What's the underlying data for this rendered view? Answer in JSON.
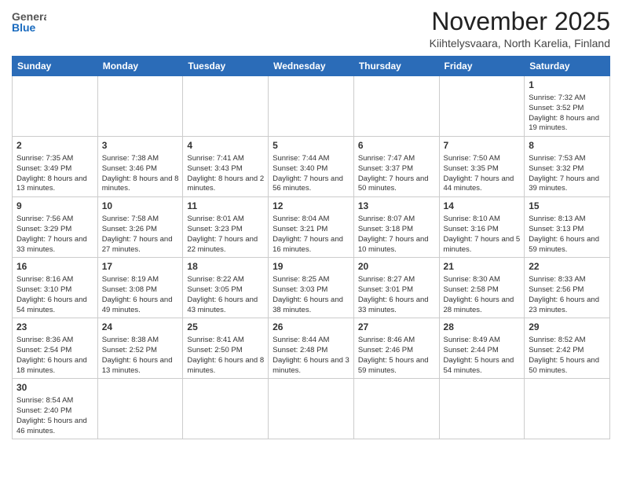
{
  "header": {
    "logo_general": "General",
    "logo_blue": "Blue",
    "month": "November 2025",
    "location": "Kiihtelysvaara, North Karelia, Finland"
  },
  "weekdays": [
    "Sunday",
    "Monday",
    "Tuesday",
    "Wednesday",
    "Thursday",
    "Friday",
    "Saturday"
  ],
  "rows": [
    [
      {
        "day": "",
        "info": ""
      },
      {
        "day": "",
        "info": ""
      },
      {
        "day": "",
        "info": ""
      },
      {
        "day": "",
        "info": ""
      },
      {
        "day": "",
        "info": ""
      },
      {
        "day": "",
        "info": ""
      },
      {
        "day": "1",
        "info": "Sunrise: 7:32 AM\nSunset: 3:52 PM\nDaylight: 8 hours\nand 19 minutes."
      }
    ],
    [
      {
        "day": "2",
        "info": "Sunrise: 7:35 AM\nSunset: 3:49 PM\nDaylight: 8 hours\nand 13 minutes."
      },
      {
        "day": "3",
        "info": "Sunrise: 7:38 AM\nSunset: 3:46 PM\nDaylight: 8 hours\nand 8 minutes."
      },
      {
        "day": "4",
        "info": "Sunrise: 7:41 AM\nSunset: 3:43 PM\nDaylight: 8 hours\nand 2 minutes."
      },
      {
        "day": "5",
        "info": "Sunrise: 7:44 AM\nSunset: 3:40 PM\nDaylight: 7 hours\nand 56 minutes."
      },
      {
        "day": "6",
        "info": "Sunrise: 7:47 AM\nSunset: 3:37 PM\nDaylight: 7 hours\nand 50 minutes."
      },
      {
        "day": "7",
        "info": "Sunrise: 7:50 AM\nSunset: 3:35 PM\nDaylight: 7 hours\nand 44 minutes."
      },
      {
        "day": "8",
        "info": "Sunrise: 7:53 AM\nSunset: 3:32 PM\nDaylight: 7 hours\nand 39 minutes."
      }
    ],
    [
      {
        "day": "9",
        "info": "Sunrise: 7:56 AM\nSunset: 3:29 PM\nDaylight: 7 hours\nand 33 minutes."
      },
      {
        "day": "10",
        "info": "Sunrise: 7:58 AM\nSunset: 3:26 PM\nDaylight: 7 hours\nand 27 minutes."
      },
      {
        "day": "11",
        "info": "Sunrise: 8:01 AM\nSunset: 3:23 PM\nDaylight: 7 hours\nand 22 minutes."
      },
      {
        "day": "12",
        "info": "Sunrise: 8:04 AM\nSunset: 3:21 PM\nDaylight: 7 hours\nand 16 minutes."
      },
      {
        "day": "13",
        "info": "Sunrise: 8:07 AM\nSunset: 3:18 PM\nDaylight: 7 hours\nand 10 minutes."
      },
      {
        "day": "14",
        "info": "Sunrise: 8:10 AM\nSunset: 3:16 PM\nDaylight: 7 hours\nand 5 minutes."
      },
      {
        "day": "15",
        "info": "Sunrise: 8:13 AM\nSunset: 3:13 PM\nDaylight: 6 hours\nand 59 minutes."
      }
    ],
    [
      {
        "day": "16",
        "info": "Sunrise: 8:16 AM\nSunset: 3:10 PM\nDaylight: 6 hours\nand 54 minutes."
      },
      {
        "day": "17",
        "info": "Sunrise: 8:19 AM\nSunset: 3:08 PM\nDaylight: 6 hours\nand 49 minutes."
      },
      {
        "day": "18",
        "info": "Sunrise: 8:22 AM\nSunset: 3:05 PM\nDaylight: 6 hours\nand 43 minutes."
      },
      {
        "day": "19",
        "info": "Sunrise: 8:25 AM\nSunset: 3:03 PM\nDaylight: 6 hours\nand 38 minutes."
      },
      {
        "day": "20",
        "info": "Sunrise: 8:27 AM\nSunset: 3:01 PM\nDaylight: 6 hours\nand 33 minutes."
      },
      {
        "day": "21",
        "info": "Sunrise: 8:30 AM\nSunset: 2:58 PM\nDaylight: 6 hours\nand 28 minutes."
      },
      {
        "day": "22",
        "info": "Sunrise: 8:33 AM\nSunset: 2:56 PM\nDaylight: 6 hours\nand 23 minutes."
      }
    ],
    [
      {
        "day": "23",
        "info": "Sunrise: 8:36 AM\nSunset: 2:54 PM\nDaylight: 6 hours\nand 18 minutes."
      },
      {
        "day": "24",
        "info": "Sunrise: 8:38 AM\nSunset: 2:52 PM\nDaylight: 6 hours\nand 13 minutes."
      },
      {
        "day": "25",
        "info": "Sunrise: 8:41 AM\nSunset: 2:50 PM\nDaylight: 6 hours\nand 8 minutes."
      },
      {
        "day": "26",
        "info": "Sunrise: 8:44 AM\nSunset: 2:48 PM\nDaylight: 6 hours\nand 3 minutes."
      },
      {
        "day": "27",
        "info": "Sunrise: 8:46 AM\nSunset: 2:46 PM\nDaylight: 5 hours\nand 59 minutes."
      },
      {
        "day": "28",
        "info": "Sunrise: 8:49 AM\nSunset: 2:44 PM\nDaylight: 5 hours\nand 54 minutes."
      },
      {
        "day": "29",
        "info": "Sunrise: 8:52 AM\nSunset: 2:42 PM\nDaylight: 5 hours\nand 50 minutes."
      }
    ],
    [
      {
        "day": "30",
        "info": "Sunrise: 8:54 AM\nSunset: 2:40 PM\nDaylight: 5 hours\nand 46 minutes."
      },
      {
        "day": "",
        "info": ""
      },
      {
        "day": "",
        "info": ""
      },
      {
        "day": "",
        "info": ""
      },
      {
        "day": "",
        "info": ""
      },
      {
        "day": "",
        "info": ""
      },
      {
        "day": "",
        "info": ""
      }
    ]
  ]
}
